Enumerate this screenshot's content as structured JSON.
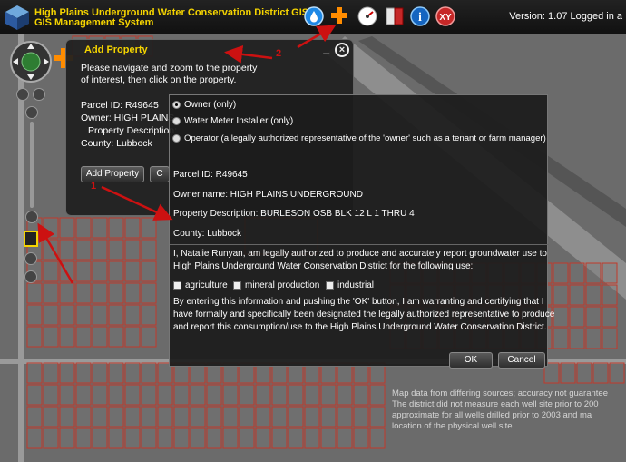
{
  "app": {
    "title_line1": "High Plains Underground Water Conservation District GIS",
    "title_line2": "GIS Management System",
    "version_text": "Version: 1.07  Logged in a"
  },
  "toolbar": {
    "icons": [
      "water-drop-icon",
      "add-property-icon",
      "gauge-icon",
      "book-icon",
      "info-icon",
      "xy-icon"
    ],
    "xy_label": "XY",
    "info_label": "i"
  },
  "add_panel": {
    "title": "Add Property",
    "instructions_line1": "Please navigate and zoom to the property",
    "instructions_line2": "of interest, then click on the property.",
    "parcel_id": "Parcel ID: R49645",
    "owner": "Owner: HIGH PLAINS",
    "property_description": "Property Description:",
    "county": "County: Lubbock",
    "add_button": "Add Property",
    "second_button": "C",
    "close_glyph": "×",
    "minimize_glyph": "_"
  },
  "dialog": {
    "options": [
      {
        "label": "Owner (only)",
        "selected": true
      },
      {
        "label": "Water Meter Installer (only)",
        "selected": false
      },
      {
        "label": "Operator (a legally authorized representative of the 'owner' such as a tenant or farm manager)",
        "selected": false
      }
    ],
    "parcel_id": "Parcel ID: R49645",
    "owner_name": "Owner name: HIGH PLAINS UNDERGROUND",
    "property_description": "Property Description: BURLESON OSB BLK 12 L 1 THRU 4",
    "county": "County: Lubbock",
    "statement_line1": "I, Natalie Runyan, am legally authorized to produce and accurately report groundwater use to",
    "statement_line2": "High Plains Underground Water Conservation District for the following use:",
    "uses": [
      "agriculture",
      "mineral production",
      "industrial"
    ],
    "cert_line1": "By entering this information and pushing the 'OK' button, I am warranting and certifying that I",
    "cert_line2": "have formally and specifically been designated the legally authorized representative to produce",
    "cert_line3": "and report this consumption/use to the High Plains Underground Water Conservation District.",
    "ok_label": "OK",
    "cancel_label": "Cancel"
  },
  "annotations": {
    "arrow1_label": "1",
    "arrow2_label": "2",
    "arrow_color": "#cc1111"
  },
  "disclaimer": {
    "line1": "Map data from differing sources; accuracy not guarantee",
    "line2": "The district did not measure each well site prior to 200",
    "line3": "approximate for all wells drilled prior to 2003 and ma",
    "line4": "location of the physical well site."
  },
  "colors": {
    "title_yellow": "#f5d400",
    "parcel_red": "#c0392b"
  }
}
